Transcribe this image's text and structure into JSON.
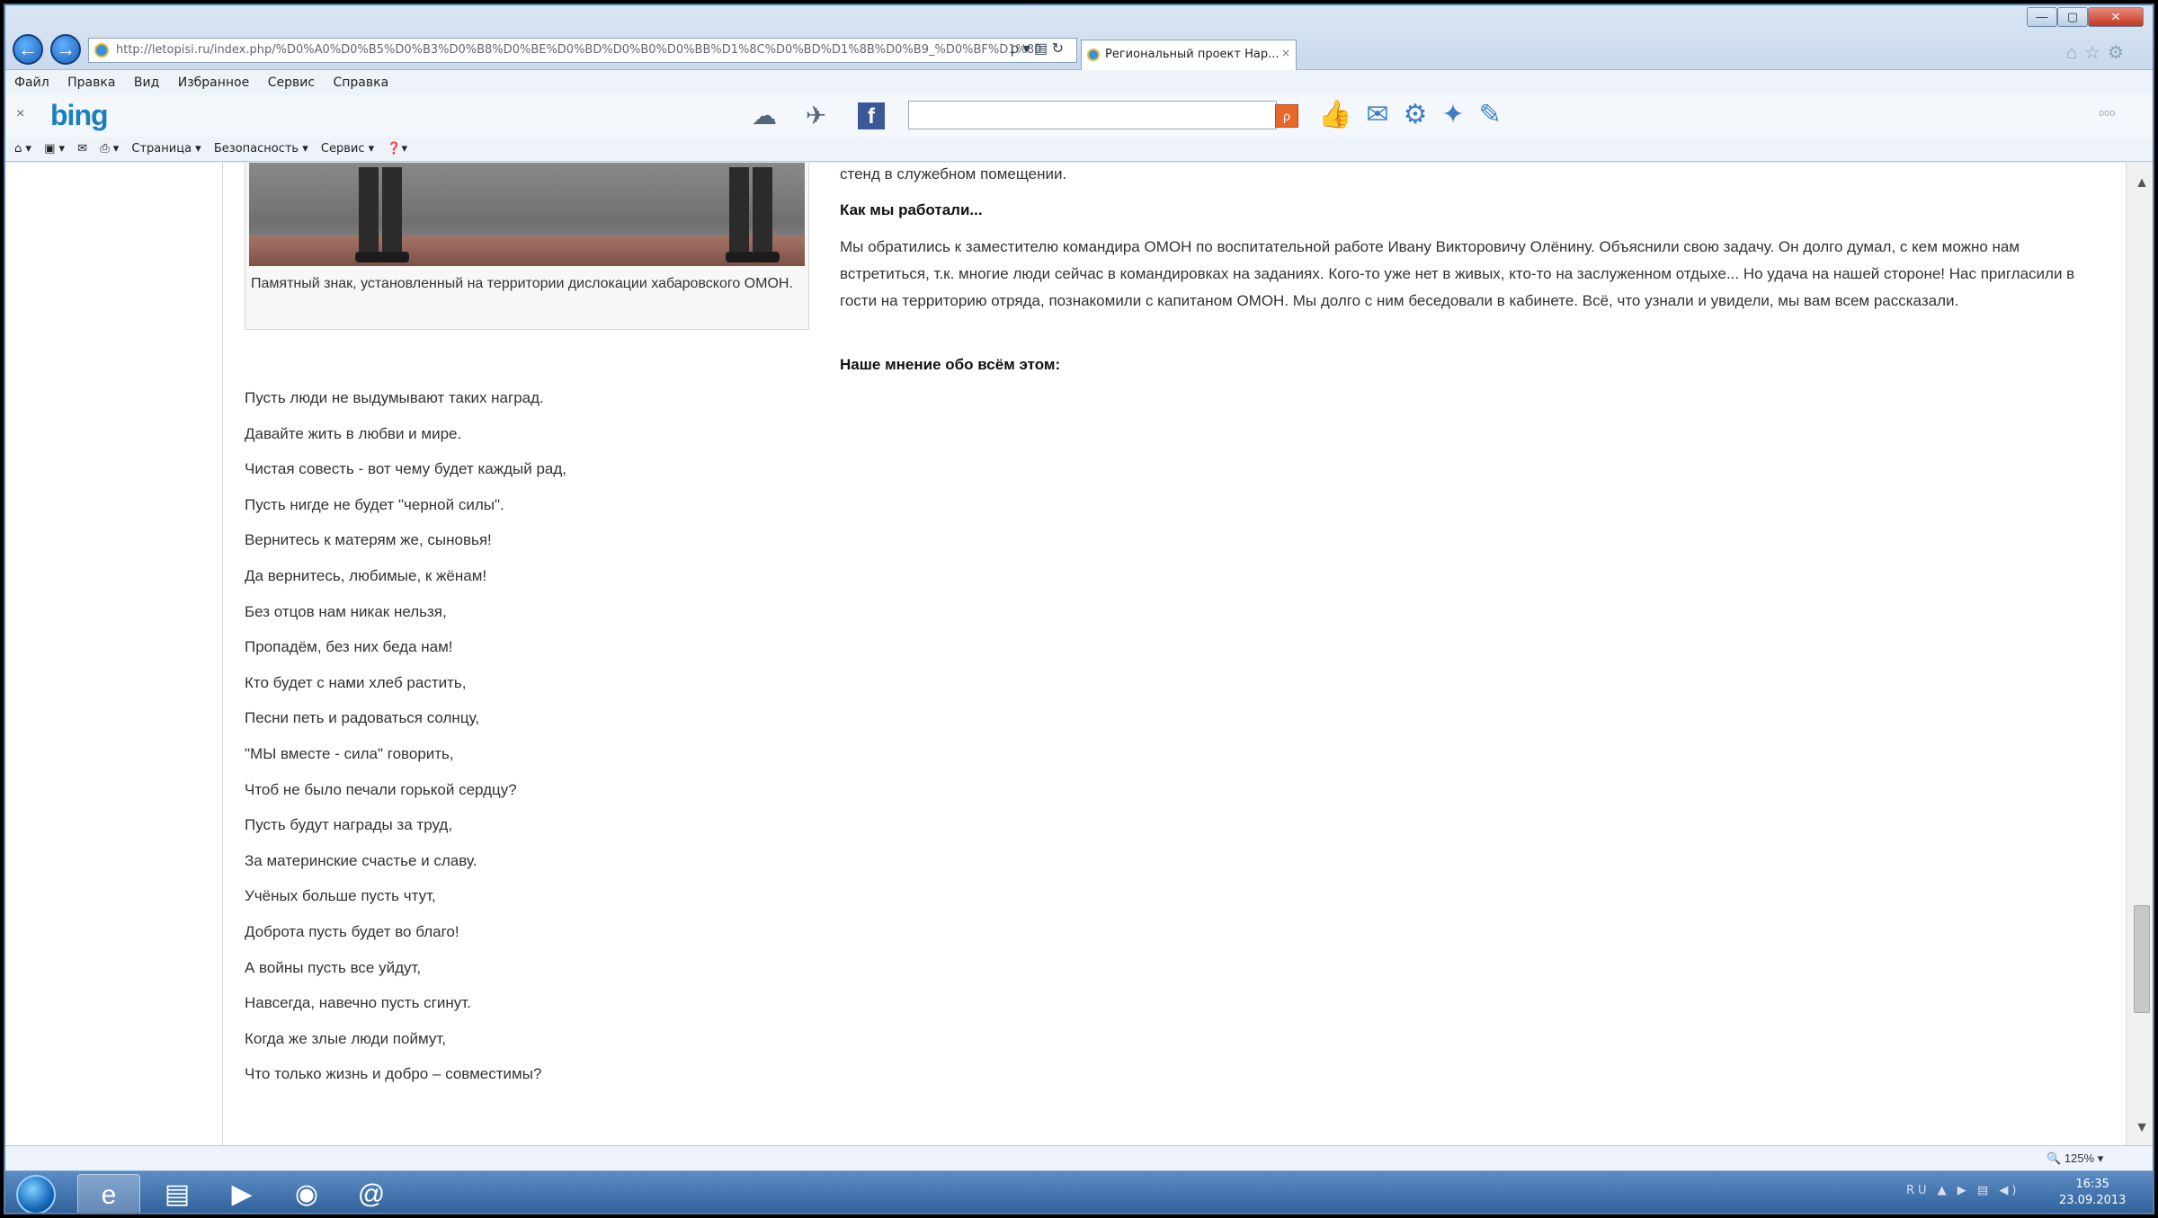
{
  "browser": {
    "address_url": "http://letopisi.ru/index.php/%D0%A0%D0%B5%D0%B3%D0%B8%D0%BE%D0%BD%D0%B0%D0%BB%D1%8C%D0%BD%D1%8B%D0%B9_%D0%BF%D1%80",
    "tab_title": "Региональный проект Нар...",
    "tab_close": "×",
    "back": "←",
    "forward": "→",
    "addr_tools": "ρ ▾ ▤ ↻",
    "window": {
      "minimize": "—",
      "maximize": "▢",
      "close": "✕"
    },
    "right_icons": "⌂☆⚙"
  },
  "menu": {
    "items": [
      "Файл",
      "Правка",
      "Вид",
      "Избранное",
      "Сервис",
      "Справка"
    ]
  },
  "bing": {
    "close": "×",
    "logo": "bing",
    "facebook": "f",
    "search_btn": "ρ",
    "more": "ooo"
  },
  "commandbar": {
    "items": [
      "⌂ ▾",
      "▣ ▾",
      "✉",
      "⎙ ▾",
      "Страница ▾",
      "Безопасность ▾",
      "Сервис ▾",
      "❓▾"
    ]
  },
  "page": {
    "photo_caption": "Памятный знак, установленный на территории дислокации хабаровского ОМОН.",
    "poem": [
      "Пусть люди не выдумывают таких наград.",
      "Давайте жить в любви и мире.",
      "Чистая совесть - вот чему будет каждый рад,",
      "Пусть нигде не будет \"черной силы\".",
      "Вернитесь к матерям же, сыновья!",
      "Да вернитесь, любимые, к жёнам!",
      "Без отцов нам никак нельзя,",
      "Пропадём, без них беда нам!",
      "Кто будет с нами хлеб растить,",
      "Песни петь и радоваться солнцу,",
      "\"МЫ вместе - сила\" говорить,",
      "Чтоб не было печали горькой сердцу?",
      "Пусть будут награды за труд,",
      "За материнские счастье и славу.",
      "Учёных больше пусть чтут,",
      "Доброта пусть будет во благо!",
      "А войны пусть все уйдут,",
      "Навсегда, навечно пусть сгинут.",
      "Когда же злые люди поймут,",
      "Что только жизнь и добро – совместимы?"
    ],
    "right": {
      "line1": "стенд в служебном помещении.",
      "heading1": "Как мы работали...",
      "paragraph": "Мы обратились к заместителю командира ОМОН по воспитательной работе Ивану Викторовичу Олёнину. Объяснили свою задачу. Он долго думал, с кем можно нам встретиться, т.к. многие люди сейчас в командировках на заданиях. Кого-то уже нет в живых, кто-то на заслуженном отдыхе... Но удача на нашей стороне! Нас пригласили в гости на территорию отряда, познакомили с капитаном ОМОН. Мы долго с ним беседовали в кабинете. Всё, что узнали и увидели, мы вам всем рассказали.",
      "heading2": "Наше мнение обо всём этом:"
    }
  },
  "status": {
    "zoom": "125%"
  },
  "taskbar": {
    "tray": "RU ▲ ▶ ▤ ◀)",
    "time": "16:35",
    "date": "23.09.2013"
  }
}
